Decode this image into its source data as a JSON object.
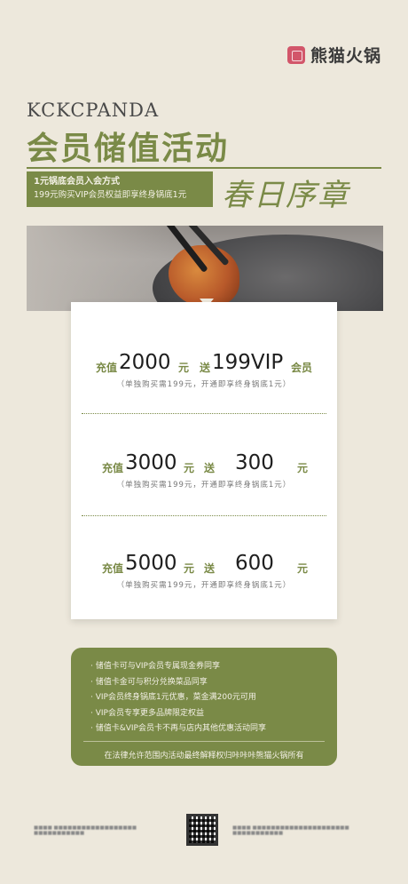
{
  "brand": {
    "logo_text": "熊猫火锅",
    "english_name": "KCKCPANDA"
  },
  "header": {
    "title": "会员储值活动",
    "subtitle": "春日序章",
    "info_line1": "1元锅底会员入会方式",
    "info_line2": "199元购买VIP会员权益即享终身锅底1元"
  },
  "offers": [
    {
      "prefix": "充值",
      "amount": "2000",
      "unit1": "元",
      "send": "送",
      "bonus": "199VIP",
      "unit2": "会员",
      "note": "（单独购买需199元，开通即享终身锅底1元）"
    },
    {
      "prefix": "充值",
      "amount": "3000",
      "unit1": "元",
      "send": "送",
      "bonus": "300",
      "unit2": "元",
      "note": "（单独购买需199元，开通即享终身锅底1元）"
    },
    {
      "prefix": "充值",
      "amount": "5000",
      "unit1": "元",
      "send": "送",
      "bonus": "600",
      "unit2": "元",
      "note": "（单独购买需199元，开通即享终身锅底1元）"
    }
  ],
  "rules": {
    "items": [
      "· 储值卡可与VIP会员专属现金券同享",
      "· 储值卡金可与积分兑换菜品同享",
      "· VIP会员终身锅底1元优惠，菜金满200元可用",
      "· VIP会员专享更多品牌限定权益",
      "· 储值卡&VIP会员卡不再与店内其他优惠活动同享"
    ],
    "final": "在法律允许范围内活动最终解释权归咔咔咔熊猫火锅所有"
  },
  "colors": {
    "accent": "#7a8a47",
    "background": "#ede8dc"
  }
}
